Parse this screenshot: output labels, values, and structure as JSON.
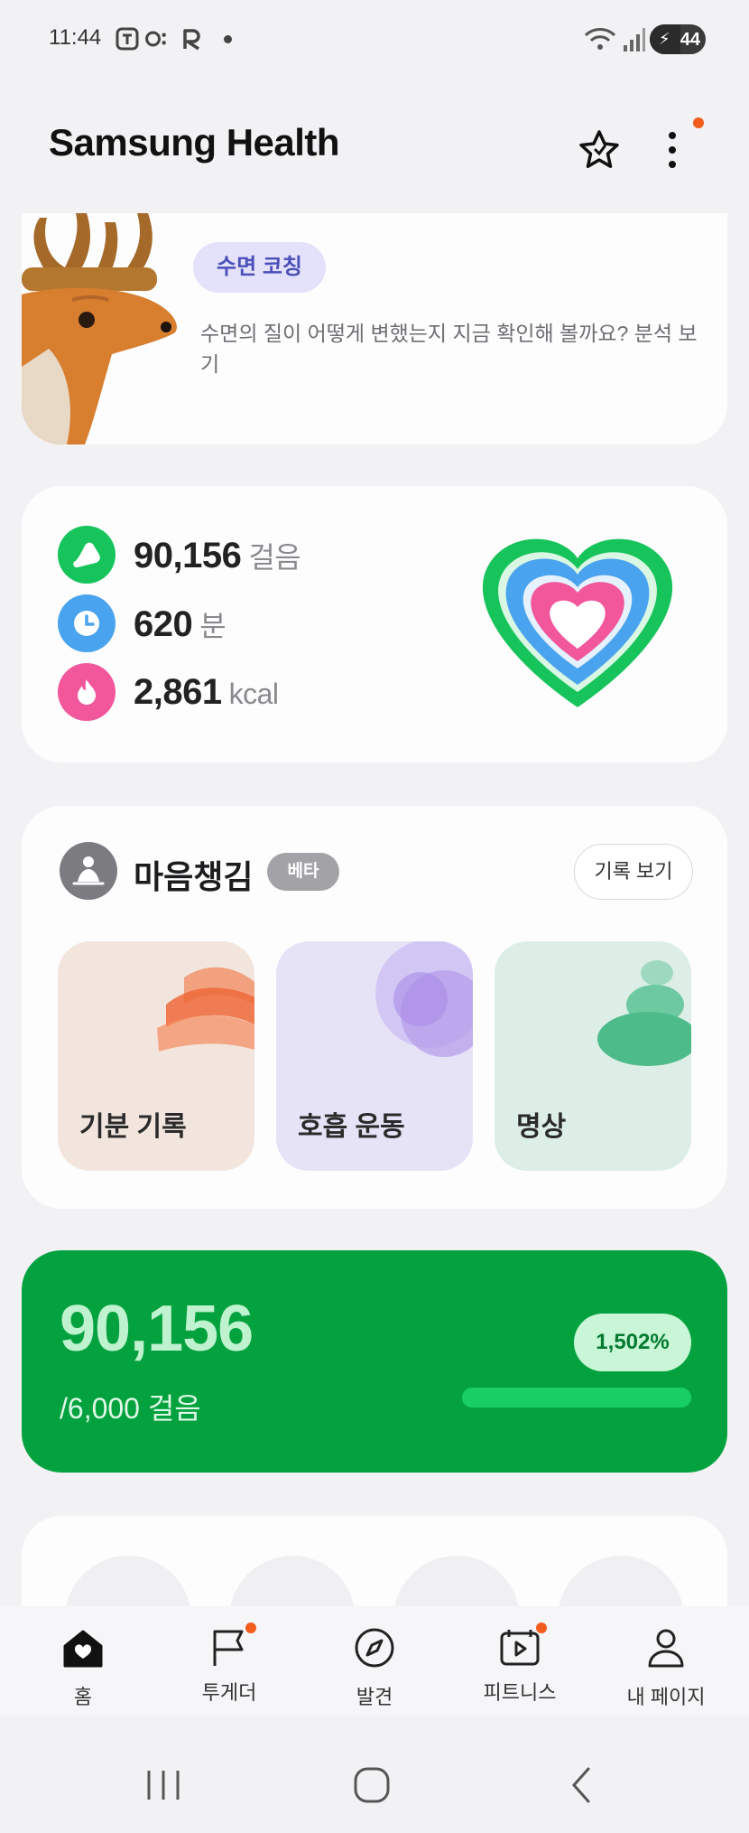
{
  "status_bar": {
    "time": "11:44",
    "battery": "44",
    "icons": [
      "t-icon",
      "o-icon",
      "r-icon",
      "wifi-icon",
      "signal-icon",
      "battery-icon"
    ]
  },
  "header": {
    "title": "Samsung Health",
    "icons": [
      "star-icon",
      "more-icon"
    ]
  },
  "sleep_coaching": {
    "pill": "수면 코칭",
    "message": "수면의 질이 어떻게 변했는지 지금 확인해 볼까요? 분석 보기"
  },
  "activity": {
    "steps_value": "90,156",
    "steps_unit": "걸음",
    "minutes_value": "620",
    "minutes_unit": "분",
    "calories_value": "2,861",
    "calories_unit": "kcal",
    "colors": {
      "steps": "#17c45c",
      "minutes": "#4aa3ee",
      "calories": "#f2569b"
    }
  },
  "mindfulness": {
    "title": "마음챙김",
    "badge": "베타",
    "record_button": "기록 보기",
    "tiles": [
      {
        "label": "기분 기록"
      },
      {
        "label": "호흡 운동"
      },
      {
        "label": "명상"
      }
    ]
  },
  "steps_card": {
    "steps": "90,156",
    "goal": "/6,000 걸음",
    "percent": "1,502%",
    "progress_fraction": 1.0
  },
  "bottom_nav": [
    {
      "label": "홈",
      "icon": "home-heart-icon"
    },
    {
      "label": "투게더",
      "icon": "flag-icon"
    },
    {
      "label": "발견",
      "icon": "compass-icon"
    },
    {
      "label": "피트니스",
      "icon": "fitness-video-icon"
    },
    {
      "label": "내 페이지",
      "icon": "person-icon"
    }
  ],
  "system_nav": [
    "recents-icon",
    "home-icon",
    "back-icon"
  ]
}
